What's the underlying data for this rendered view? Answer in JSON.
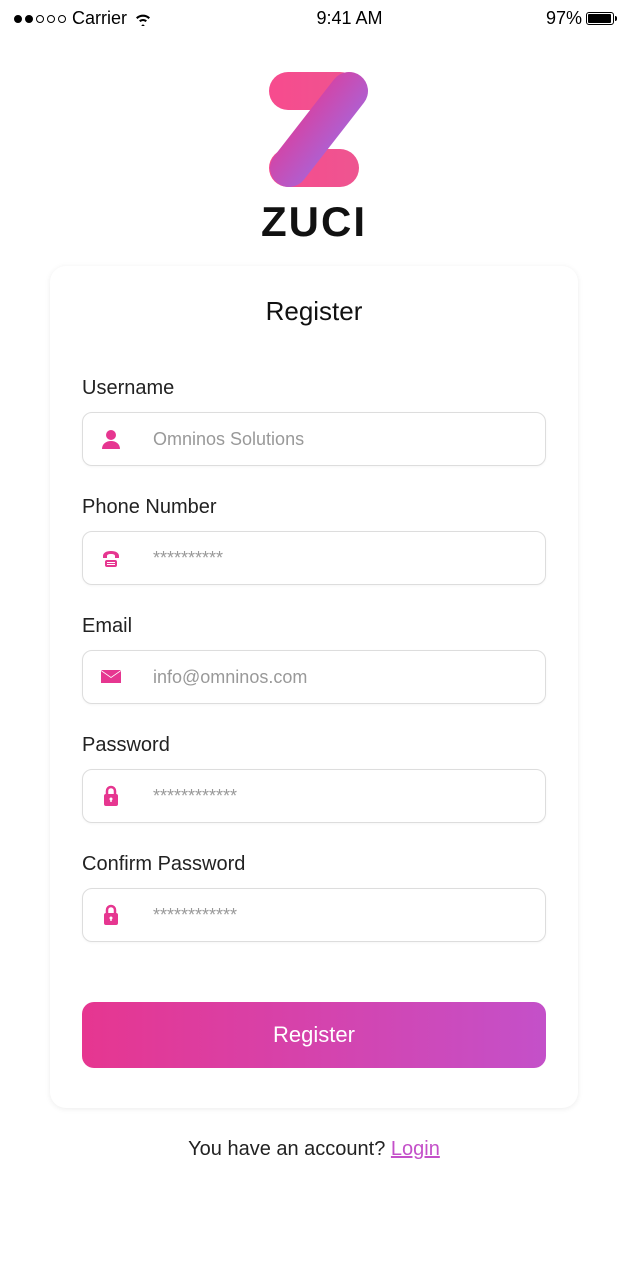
{
  "status_bar": {
    "carrier": "Carrier",
    "time": "9:41 AM",
    "battery_percent": "97%"
  },
  "logo": {
    "brand_name": "ZUCI"
  },
  "card": {
    "title": "Register",
    "username": {
      "label": "Username",
      "placeholder": "Omninos Solutions"
    },
    "phone": {
      "label": "Phone Number",
      "placeholder": "**********"
    },
    "email": {
      "label": "Email",
      "placeholder": "info@omninos.com"
    },
    "password": {
      "label": "Password",
      "placeholder": "************"
    },
    "confirm_password": {
      "label": "Confirm Password",
      "placeholder": "************"
    },
    "register_button": "Register"
  },
  "footer": {
    "text": "You have an account? ",
    "login_link": "Login"
  },
  "colors": {
    "accent": "#e63690",
    "accent2": "#c450c9"
  }
}
